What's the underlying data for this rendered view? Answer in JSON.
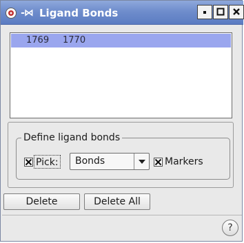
{
  "window": {
    "title": "Ligand Bonds",
    "title_glyph": "-⋈",
    "icons": [
      "app-icon",
      "pin-icon",
      "minimize-icon",
      "maximize-icon",
      "close-icon"
    ]
  },
  "bond_list": {
    "rows": [
      {
        "atom1": "1769",
        "atom2": "1770",
        "selected": true
      }
    ],
    "selection_color": "#9aa6ee"
  },
  "define_group": {
    "title": "Define ligand bonds",
    "pick": {
      "label": "Pick:",
      "checked": true
    },
    "mode_select": {
      "selected": "Bonds"
    },
    "markers": {
      "label": "Markers",
      "checked": true
    }
  },
  "buttons": {
    "delete": "Delete",
    "delete_all": "Delete All"
  },
  "help": {
    "glyph": "?"
  },
  "colors": {
    "titlebar": "#6f8dcc",
    "window_bg": "#e9e9e9"
  }
}
